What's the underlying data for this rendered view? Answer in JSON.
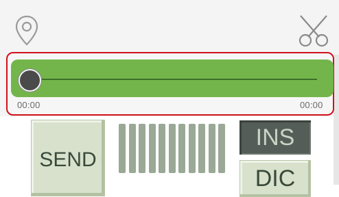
{
  "toolbar": {
    "location_icon": "location-pin-icon",
    "cut_icon": "scissors-icon"
  },
  "player": {
    "current_time": "00:00",
    "total_time": "00:00",
    "progress": 0,
    "track_color": "#73b54a",
    "highlight_color": "#d2101a"
  },
  "controls": {
    "send_label": "SEND",
    "ins_label": "INS",
    "dic_label": "DIC",
    "level_bar_count": 11
  }
}
